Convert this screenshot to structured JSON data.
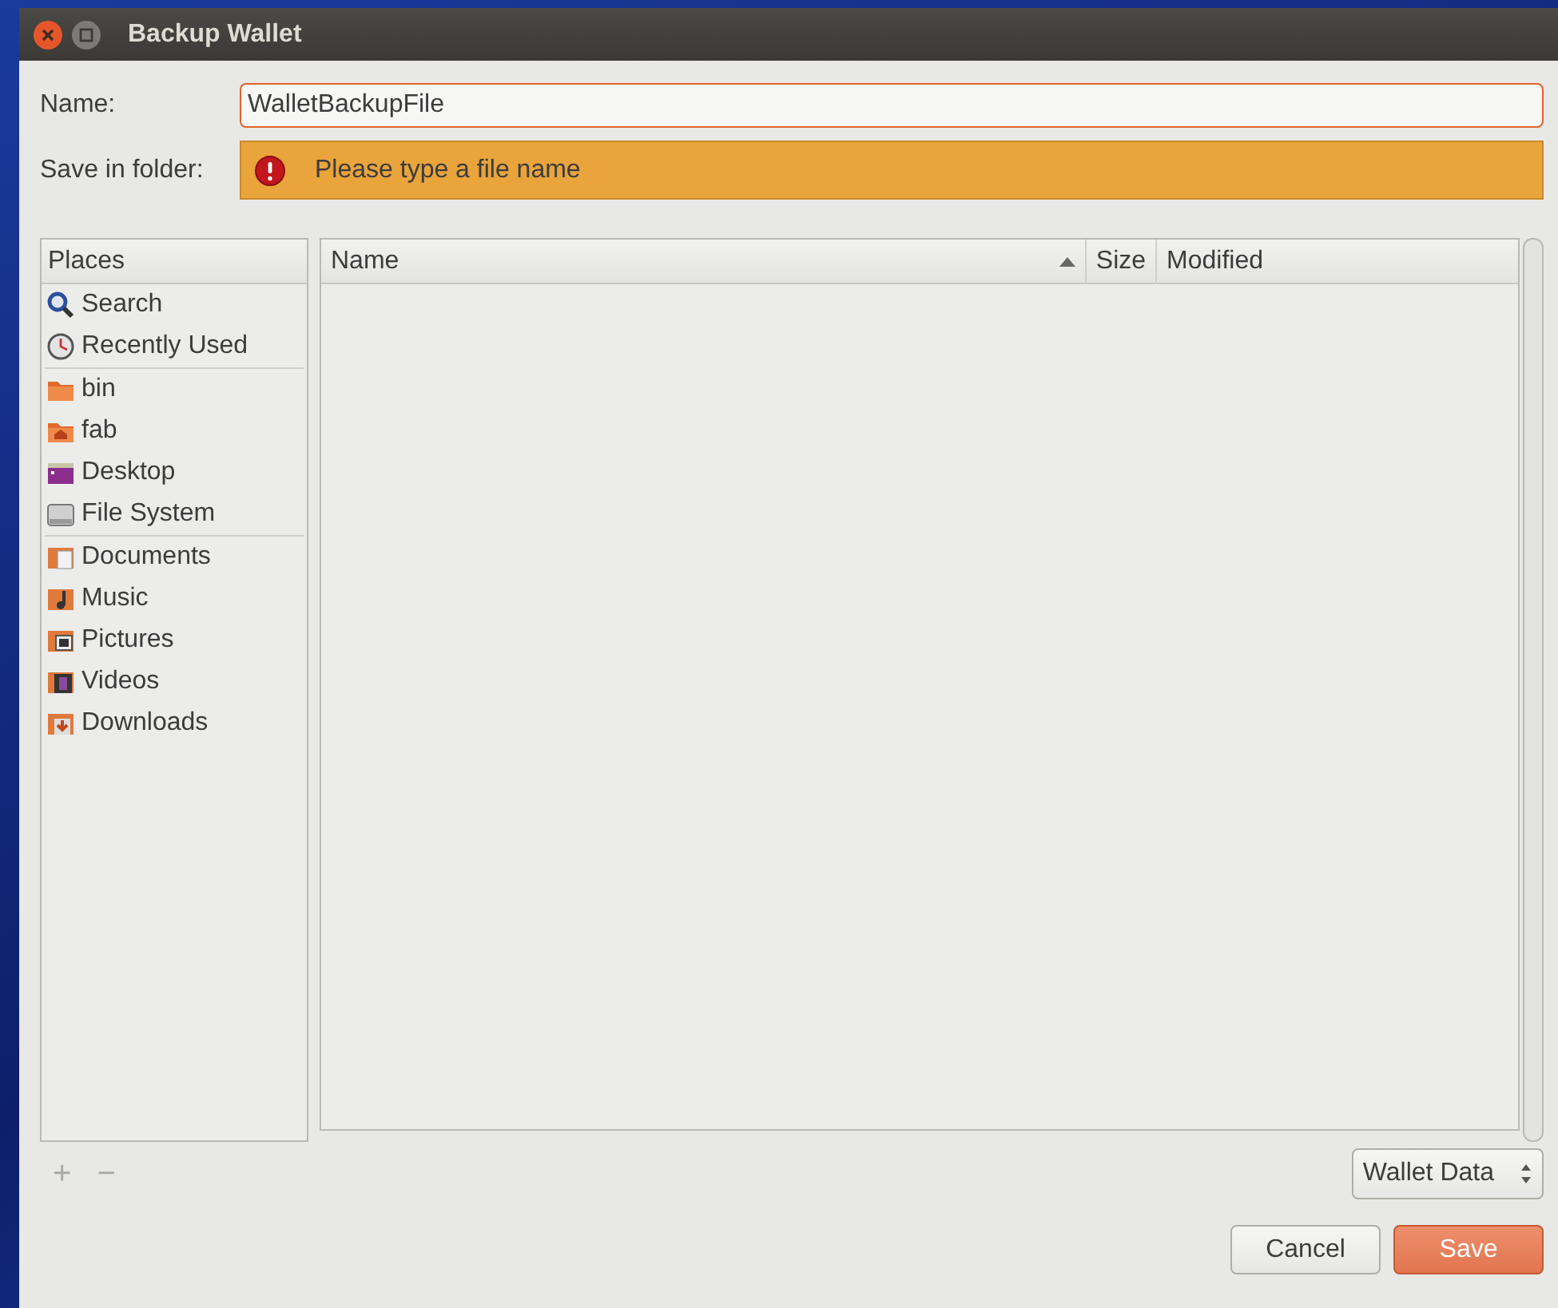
{
  "window": {
    "title": "Backup Wallet"
  },
  "name_row": {
    "label": "Name:",
    "value": "WalletBackupFile"
  },
  "folder_row": {
    "label": "Save in folder:",
    "error": "Please type a file name"
  },
  "places": {
    "title": "Places",
    "groups": [
      {
        "items": [
          {
            "label": "Search",
            "kind": "search"
          },
          {
            "label": "Recently Used",
            "kind": "recent"
          }
        ]
      },
      {
        "items": [
          {
            "label": "bin",
            "kind": "folder"
          },
          {
            "label": "fab",
            "kind": "home"
          },
          {
            "label": "Desktop",
            "kind": "desktop"
          },
          {
            "label": "File System",
            "kind": "drive"
          }
        ]
      },
      {
        "items": [
          {
            "label": "Documents",
            "kind": "documents"
          },
          {
            "label": "Music",
            "kind": "music"
          },
          {
            "label": "Pictures",
            "kind": "pictures"
          },
          {
            "label": "Videos",
            "kind": "videos"
          },
          {
            "label": "Downloads",
            "kind": "downloads"
          }
        ]
      }
    ]
  },
  "file_list": {
    "columns": [
      {
        "label": "Name",
        "sorted": true
      },
      {
        "label": "Size",
        "sorted": false
      },
      {
        "label": "Modified",
        "sorted": false
      }
    ]
  },
  "place_buttons": [
    {
      "label": "+",
      "disabled": true
    },
    {
      "label": "−",
      "disabled": true
    }
  ],
  "filter": {
    "value": "Wallet Data"
  },
  "buttons": [
    {
      "label": "Cancel",
      "kind": "secondary"
    },
    {
      "label": "Save",
      "kind": "primary"
    }
  ]
}
